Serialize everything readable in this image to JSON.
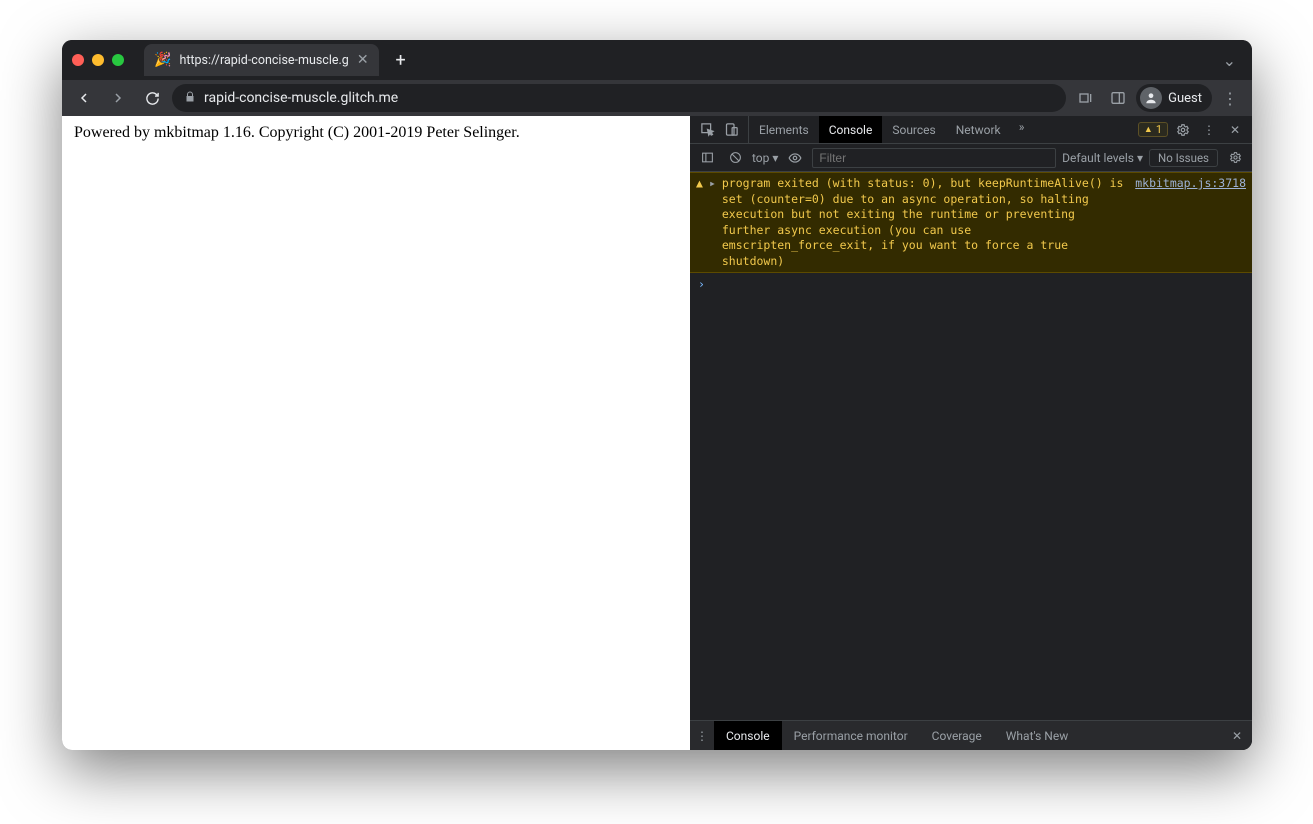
{
  "tab": {
    "title": "https://rapid-concise-muscle.g",
    "favicon": "🎉"
  },
  "toolbar": {
    "url": "rapid-concise-muscle.glitch.me",
    "profile_label": "Guest"
  },
  "page": {
    "body_text": "Powered by mkbitmap 1.16. Copyright (C) 2001-2019 Peter Selinger."
  },
  "devtools": {
    "tabs": {
      "elements": "Elements",
      "console": "Console",
      "sources": "Sources",
      "network": "Network"
    },
    "warning_count": "1",
    "console_bar": {
      "context": "top",
      "filter_placeholder": "Filter",
      "levels_label": "Default levels",
      "issues_label": "No Issues"
    },
    "warning": {
      "message": "program exited (with status: 0), but keepRuntimeAlive() is set (counter=0) due to an async operation, so halting execution but not exiting the runtime or preventing further async execution (you can use emscripten_force_exit, if you want to force a true shutdown)",
      "source": "mkbitmap.js:3718"
    },
    "drawer": {
      "console": "Console",
      "perf": "Performance monitor",
      "coverage": "Coverage",
      "whatsnew": "What's New"
    }
  }
}
